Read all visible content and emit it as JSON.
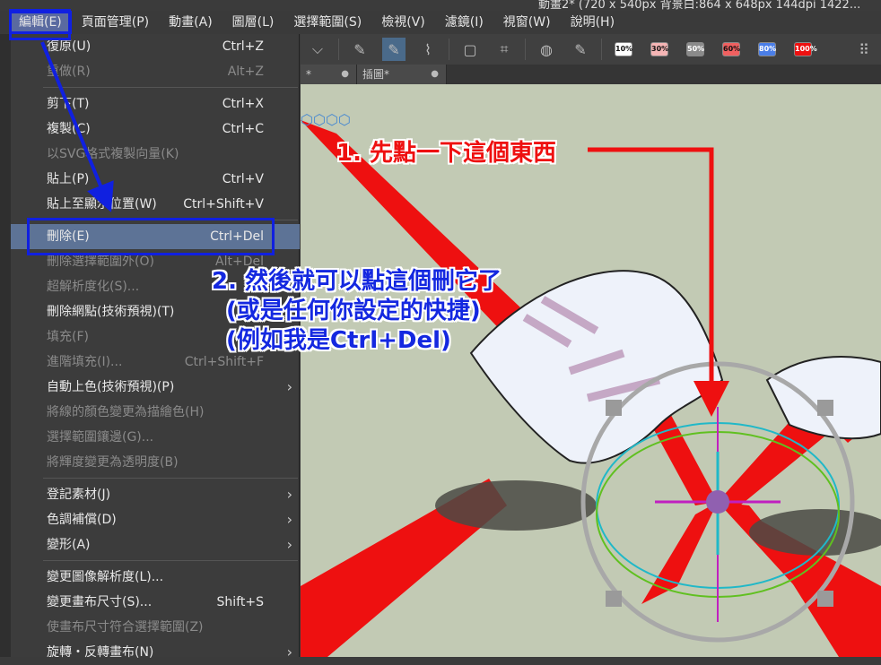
{
  "window": {
    "title_partial": "動畫2* (720 x 540px 背景白:864 x 648px 144dpi 1422..."
  },
  "menubar": [
    "編輯(E)",
    "頁面管理(P)",
    "動畫(A)",
    "圖層(L)",
    "選擇範圍(S)",
    "檢視(V)",
    "濾鏡(I)",
    "視窗(W)",
    "說明(H)"
  ],
  "toolbar": {
    "opacity_presets": [
      {
        "label": "10%",
        "color": "#ffffff"
      },
      {
        "label": "30%",
        "color": "#f5b5b5"
      },
      {
        "label": "50%",
        "color": "#8a8a8a"
      },
      {
        "label": "60%",
        "color": "#f06060"
      },
      {
        "label": "80%",
        "color": "#4a7ee8"
      },
      {
        "label": "100%",
        "color": "#ee1010"
      }
    ]
  },
  "tabs": [
    {
      "label": "*"
    },
    {
      "label": "插圖*"
    }
  ],
  "edit_menu": [
    {
      "label": "復原(U)",
      "shortcut": "Ctrl+Z",
      "disabled": false
    },
    {
      "label": "重做(R)",
      "shortcut": "Alt+Z",
      "disabled": true
    },
    {
      "sep": true
    },
    {
      "label": "剪下(T)",
      "shortcut": "Ctrl+X",
      "disabled": false
    },
    {
      "label": "複製(C)",
      "shortcut": "Ctrl+C",
      "disabled": false
    },
    {
      "label": "以SVG格式複製向量(K)",
      "shortcut": "",
      "disabled": true
    },
    {
      "label": "貼上(P)",
      "shortcut": "Ctrl+V",
      "disabled": false
    },
    {
      "label": "貼上至顯示位置(W)",
      "shortcut": "Ctrl+Shift+V",
      "disabled": false
    },
    {
      "sep": true
    },
    {
      "label": "刪除(E)",
      "shortcut": "Ctrl+Del",
      "disabled": false,
      "highlight": true
    },
    {
      "label": "刪除選擇範圍外(O)",
      "shortcut": "Alt+Del",
      "disabled": true
    },
    {
      "label": "超解析度化(S)...",
      "shortcut": "",
      "disabled": true
    },
    {
      "label": "刪除網點(技術預視)(T)",
      "shortcut": "",
      "disabled": false
    },
    {
      "label": "填充(F)",
      "shortcut": "",
      "disabled": true
    },
    {
      "label": "進階填充(I)...",
      "shortcut": "Ctrl+Shift+F",
      "disabled": true
    },
    {
      "label": "自動上色(技術預視)(P)",
      "shortcut": "",
      "disabled": false,
      "submenu": true
    },
    {
      "label": "將線的顏色變更為描繪色(H)",
      "shortcut": "",
      "disabled": true
    },
    {
      "label": "選擇範圍鑲邊(G)...",
      "shortcut": "",
      "disabled": true
    },
    {
      "label": "將輝度變更為透明度(B)",
      "shortcut": "",
      "disabled": true
    },
    {
      "sep": true
    },
    {
      "label": "登記素材(J)",
      "shortcut": "",
      "disabled": false,
      "submenu": true
    },
    {
      "label": "色調補償(D)",
      "shortcut": "",
      "disabled": false,
      "submenu": true
    },
    {
      "label": "變形(A)",
      "shortcut": "",
      "disabled": false,
      "submenu": true
    },
    {
      "sep": true
    },
    {
      "label": "變更圖像解析度(L)...",
      "shortcut": "",
      "disabled": false
    },
    {
      "label": "變更畫布尺寸(S)...",
      "shortcut": "Shift+S",
      "disabled": false
    },
    {
      "label": "使畫布尺寸符合選擇範圍(Z)",
      "shortcut": "",
      "disabled": true
    },
    {
      "label": "旋轉・反轉畫布(N)",
      "shortcut": "",
      "disabled": false,
      "submenu": true
    }
  ],
  "annotations": {
    "step1": "1. 先點一下這個東西",
    "step2_lines": [
      "2. 然後就可以點這個刪它了",
      "(或是任何你設定的快捷)",
      "(例如我是Ctrl+Del)"
    ],
    "colors": {
      "step1": "#ee1010",
      "step2": "#1428e0"
    }
  },
  "colors": {
    "menu_bg": "#3c3c3c",
    "highlight": "#5d7396",
    "canvas_bg": "#c2cab4",
    "annotation_box": "#1020e0"
  }
}
